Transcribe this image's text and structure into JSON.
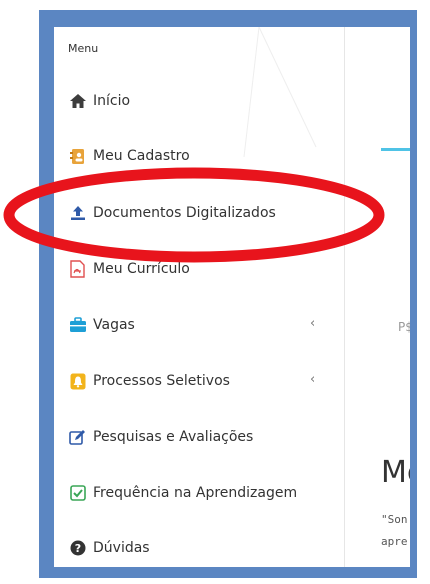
{
  "menu": {
    "title": "Menu",
    "items": [
      {
        "label": "Início",
        "icon": "home-icon"
      },
      {
        "label": "Meu Cadastro",
        "icon": "address-book-icon"
      },
      {
        "label": "Documentos Digitalizados",
        "icon": "upload-icon"
      },
      {
        "label": "Meu Currículo",
        "icon": "pdf-file-icon"
      },
      {
        "label": "Vagas",
        "icon": "briefcase-icon",
        "chevron": "‹"
      },
      {
        "label": "Processos Seletivos",
        "icon": "bell-icon",
        "chevron": "‹"
      },
      {
        "label": "Pesquisas e Avaliações",
        "icon": "edit-icon"
      },
      {
        "label": "Frequência na Aprendizagem",
        "icon": "check-square-icon"
      },
      {
        "label": "Dúvidas",
        "icon": "question-circle-icon"
      }
    ]
  },
  "content": {
    "fragment_ps": "P$",
    "fragment_heading": "Me",
    "fragment_line1": "\"Son",
    "fragment_line2": "apre"
  },
  "colors": {
    "frame": "#5b86c2",
    "annotation_ellipse": "#e8141c",
    "accent": "#4fc3e6"
  }
}
